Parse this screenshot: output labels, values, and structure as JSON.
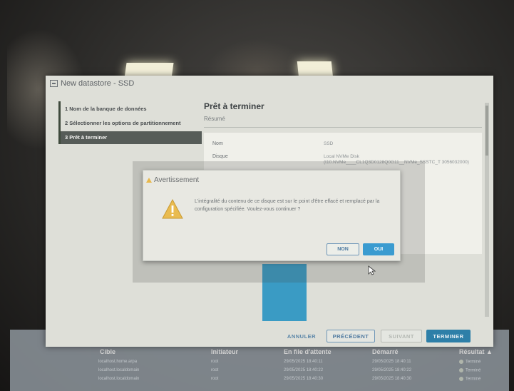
{
  "wizard": {
    "title": "New datastore - SSD",
    "steps": [
      {
        "label": "1  Nom de la banque de données"
      },
      {
        "label": "2  Sélectionner les options de partitionnement"
      },
      {
        "label": "3  Prêt à terminer"
      }
    ],
    "content_title": "Prêt à terminer",
    "content_subtitle": "Résumé",
    "summary": [
      {
        "label": "Nom",
        "value": "SSD"
      },
      {
        "label": "Disque",
        "value": "Local NVMe Disk (t10.NVMe____CL1Q3D0128Q0G11__NVMe_SSSTC_T                  3056032000)"
      }
    ],
    "buttons": {
      "cancel": "ANNULER",
      "previous": "PRÉCÉDENT",
      "next": "SUIVANT",
      "finish": "TERMINER"
    }
  },
  "alert": {
    "title": "Avertissement",
    "message": "L'intégralité du contenu de ce disque est sur le point d'être effacé et remplacé par la configuration spécifiée. Voulez-vous continuer ?",
    "no_label": "NON",
    "yes_label": "OUI"
  },
  "tasks": {
    "headers": [
      "Cible",
      "Initiateur",
      "En file d'attente",
      "Démarré",
      "Résultat ▲"
    ],
    "rows": [
      {
        "target": "localhost.home.arpa",
        "initiator": "root",
        "queued": "29/05/2025 18:40:11",
        "started": "29/05/2025 18:40:11",
        "result": "Terminé"
      },
      {
        "target": "localhost.localdomain",
        "initiator": "root",
        "queued": "29/05/2025 18:40:22",
        "started": "29/05/2025 18:40:22",
        "result": "Terminé"
      },
      {
        "target": "localhost.localdomain",
        "initiator": "root",
        "queued": "29/05/2025 18:40:30",
        "started": "29/05/2025 18:40:30",
        "result": "Terminé"
      }
    ]
  },
  "colors": {
    "accent": "#3a9bd0",
    "primary_button": "#2d7fa8",
    "warning": "#e8b84b",
    "dialog_bg": "#e8e8e2"
  }
}
